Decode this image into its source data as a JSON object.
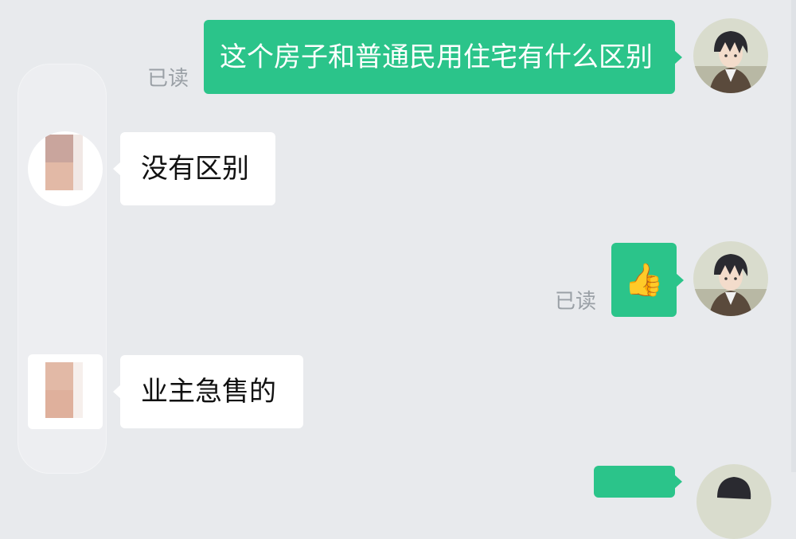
{
  "messages": [
    {
      "side": "out",
      "text": "这个房子和普通民用住宅有什么区别",
      "status": "已读"
    },
    {
      "side": "in",
      "text": "没有区别"
    },
    {
      "side": "out",
      "emoji": "👍",
      "status": "已读"
    },
    {
      "side": "in",
      "text": "业主急售的"
    }
  ],
  "colors": {
    "background": "#e8eaed",
    "outgoing_bubble": "#2bc48a",
    "incoming_bubble": "#ffffff",
    "read_status": "#9aa0a6"
  }
}
